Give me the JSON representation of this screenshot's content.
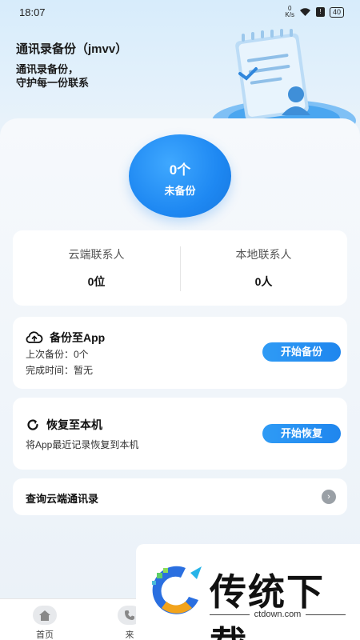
{
  "status_bar": {
    "time": "18:07",
    "net_speed_top": "0",
    "net_speed_bottom": "K/s",
    "battery": "40"
  },
  "header": {
    "title": "通讯录备份（jmvv）",
    "slogan_line1": "通讯录备份，",
    "slogan_line2": "守护每一份联系"
  },
  "backup_status": {
    "count": "0个",
    "state": "未备份"
  },
  "stats": {
    "cloud_label": "云端联系人",
    "cloud_value": "0位",
    "local_label": "本地联系人",
    "local_value": "0人"
  },
  "backup_card": {
    "title": "备份至App",
    "last_backup": "上次备份：0个",
    "finish_time": "完成时间：暂无",
    "button": "开始备份"
  },
  "restore_card": {
    "title": "恢复至本机",
    "description": "将App最近记录恢复到本机",
    "button": "开始恢复"
  },
  "query": {
    "label": "查询云端通讯录"
  },
  "nav": {
    "home": "首页",
    "partial": "来"
  },
  "watermark": {
    "brand": "传统下载",
    "url": "ctdown.com"
  },
  "colors": {
    "accent": "#1e88f2",
    "header_bg": "#d7ecfb"
  }
}
